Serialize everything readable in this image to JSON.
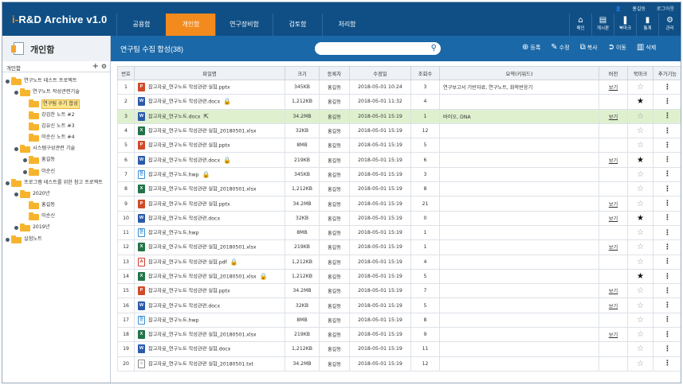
{
  "app": {
    "logo_lead": "i-",
    "logo_rest": "R&D Archive v1.0"
  },
  "util": {
    "user": "홍길동",
    "logout": "로그아웃"
  },
  "nav": [
    {
      "label": "공용함",
      "active": false
    },
    {
      "label": "개인함",
      "active": true
    },
    {
      "label": "연구장비함",
      "active": false,
      "wide": true
    },
    {
      "label": "검토함",
      "active": false
    },
    {
      "label": "처리함",
      "active": false
    }
  ],
  "tools": [
    {
      "label": "메인",
      "icon": "home-icon",
      "glyph": "⌂"
    },
    {
      "label": "게시판",
      "icon": "board-icon",
      "glyph": "▤"
    },
    {
      "label": "북마크",
      "icon": "bookmark-icon",
      "glyph": "❚"
    },
    {
      "label": "통계",
      "icon": "chart-icon",
      "glyph": "▮"
    },
    {
      "label": "관리",
      "icon": "gear-icon",
      "glyph": "⚙"
    }
  ],
  "sidebar": {
    "title": "개인함",
    "tab_label": "개인함",
    "tree": [
      {
        "label": "연구노트 테스트 프로젝트",
        "depth": 0,
        "toggle": true
      },
      {
        "label": "연구노트 작성관련기술",
        "depth": 1,
        "toggle": true
      },
      {
        "label": "연구팀 수기 합성",
        "depth": 2,
        "toggle": false,
        "selected": true
      },
      {
        "label": "강감찬 노트 #2",
        "depth": 2,
        "toggle": false
      },
      {
        "label": "김유신 노트 #3",
        "depth": 2,
        "toggle": false
      },
      {
        "label": "이순신 노트 #4",
        "depth": 2,
        "toggle": false
      },
      {
        "label": "시스템구성관련 기술",
        "depth": 1,
        "toggle": true
      },
      {
        "label": "홍길동",
        "depth": 2,
        "toggle": true
      },
      {
        "label": "이순신",
        "depth": 2,
        "toggle": true
      },
      {
        "label": "프로그램 테스트를 위한 참고 프로젝트",
        "depth": 0,
        "toggle": true
      },
      {
        "label": "2020년",
        "depth": 1,
        "toggle": true
      },
      {
        "label": "홍길동",
        "depth": 2,
        "toggle": false
      },
      {
        "label": "이순신",
        "depth": 2,
        "toggle": false
      },
      {
        "label": "2019년",
        "depth": 1,
        "toggle": true
      },
      {
        "label": "실험노트",
        "depth": 0,
        "toggle": true
      }
    ]
  },
  "main": {
    "title": "연구팀 수집 합성(38)",
    "search_placeholder": "",
    "actions": [
      {
        "label": "등록",
        "icon": "add-icon",
        "glyph": "⊕"
      },
      {
        "label": "수정",
        "icon": "edit-icon",
        "glyph": "✎"
      },
      {
        "label": "복사",
        "icon": "copy-icon",
        "glyph": "⧉"
      },
      {
        "label": "이동",
        "icon": "move-icon",
        "glyph": "➲"
      },
      {
        "label": "삭제",
        "icon": "trash-icon",
        "glyph": "▥"
      }
    ]
  },
  "table": {
    "headers": [
      "번호",
      "파일명",
      "크기",
      "등록자",
      "수정일",
      "조회수",
      "요약(키워드)",
      "버전",
      "북마크",
      "추가기능"
    ],
    "view_label": "보기",
    "rows": [
      {
        "no": "1",
        "type": "pptx",
        "name": "참고자료_연구노트 작성관련 실험.pptx",
        "lock": "",
        "size": "345KB",
        "owner": "홍길동",
        "date": "2018-05-01 10:24",
        "views": "3",
        "summary": "연구보고서 기반자료, 연구노트, 화학반응기",
        "ver": true,
        "star": false
      },
      {
        "no": "2",
        "type": "docx",
        "name": "참고자료_연구노트 작성관련.docx",
        "lock": "🔒",
        "size": "1,212KB",
        "owner": "홍길동",
        "date": "2018-05-01 11:32",
        "views": "4",
        "summary": "",
        "ver": false,
        "star": true
      },
      {
        "no": "3",
        "type": "docx",
        "name": "참고자료_연구노트.docx",
        "lock": "⇱",
        "size": "34.2MB",
        "owner": "홍길동",
        "date": "2018-05-01 15:19",
        "views": "1",
        "summary": "바이오, DNA",
        "ver": true,
        "star": false,
        "hl": true
      },
      {
        "no": "4",
        "type": "xlsx",
        "name": "참고자료_연구노트 작성관련 실험_20180501.xlsx",
        "lock": "",
        "size": "32KB",
        "owner": "홍길동",
        "date": "2018-05-01 15:19",
        "views": "12",
        "summary": "",
        "ver": false,
        "star": false
      },
      {
        "no": "5",
        "type": "pptx",
        "name": "참고자료_연구노트 작성관련 실험.pptx",
        "lock": "",
        "size": "8MB",
        "owner": "홍길동",
        "date": "2018-05-01 15:19",
        "views": "5",
        "summary": "",
        "ver": false,
        "star": false
      },
      {
        "no": "6",
        "type": "docx",
        "name": "참고자료_연구노트 작성관련.docx",
        "lock": "🔒",
        "size": "219KB",
        "owner": "홍길동",
        "date": "2018-05-01 15:19",
        "views": "6",
        "summary": "",
        "ver": true,
        "star": true
      },
      {
        "no": "7",
        "type": "hwp",
        "name": "참고자료_연구노트.hwp",
        "lock": "🔒",
        "size": "345KB",
        "owner": "홍길동",
        "date": "2018-05-01 15:19",
        "views": "3",
        "summary": "",
        "ver": false,
        "star": false
      },
      {
        "no": "8",
        "type": "xlsx",
        "name": "참고자료_연구노트 작성관련 실험_20180501.xlsx",
        "lock": "",
        "size": "1,212KB",
        "owner": "홍길동",
        "date": "2018-05-01 15:19",
        "views": "8",
        "summary": "",
        "ver": false,
        "star": false
      },
      {
        "no": "9",
        "type": "pptx",
        "name": "참고자료_연구노트 작성관련 실험.pptx",
        "lock": "",
        "size": "34.2MB",
        "owner": "홍길동",
        "date": "2018-05-01 15:19",
        "views": "21",
        "summary": "",
        "ver": true,
        "star": false
      },
      {
        "no": "10",
        "type": "docx",
        "name": "참고자료_연구노트 작성관련.docx",
        "lock": "",
        "size": "32KB",
        "owner": "홍길동",
        "date": "2018-05-01 15:19",
        "views": "0",
        "summary": "",
        "ver": true,
        "star": true
      },
      {
        "no": "11",
        "type": "hwp",
        "name": "참고자료_연구노트.hwp",
        "lock": "",
        "size": "8MB",
        "owner": "홍길동",
        "date": "2018-05-01 15:19",
        "views": "1",
        "summary": "",
        "ver": false,
        "star": false
      },
      {
        "no": "12",
        "type": "xlsx",
        "name": "참고자료_연구노트 작성관련 실험_20180501.xlsx",
        "lock": "",
        "size": "219KB",
        "owner": "홍길동",
        "date": "2018-05-01 15:19",
        "views": "1",
        "summary": "",
        "ver": true,
        "star": false
      },
      {
        "no": "13",
        "type": "pdf",
        "name": "참고자료_연구노트 작성관련 실험.pdf",
        "lock": "🔒",
        "size": "1,212KB",
        "owner": "홍길동",
        "date": "2018-05-01 15:19",
        "views": "4",
        "summary": "",
        "ver": false,
        "star": false
      },
      {
        "no": "14",
        "type": "xlsx",
        "name": "참고자료_연구노트 작성관련 실험_20180501.xlsx",
        "lock": "🔒",
        "size": "1,212KB",
        "owner": "홍길동",
        "date": "2018-05-01 15:19",
        "views": "5",
        "summary": "",
        "ver": false,
        "star": true
      },
      {
        "no": "15",
        "type": "pptx",
        "name": "참고자료_연구노트 작성관련 실험.pptx",
        "lock": "",
        "size": "34.2MB",
        "owner": "홍길동",
        "date": "2018-05-01 15:19",
        "views": "7",
        "summary": "",
        "ver": true,
        "star": false
      },
      {
        "no": "16",
        "type": "docx",
        "name": "참고자료_연구노트 작성관련.docx",
        "lock": "",
        "size": "32KB",
        "owner": "홍길동",
        "date": "2018-05-01 15:19",
        "views": "5",
        "summary": "",
        "ver": true,
        "star": false
      },
      {
        "no": "17",
        "type": "hwp",
        "name": "참고자료_연구노트.hwp",
        "lock": "",
        "size": "8MB",
        "owner": "홍길동",
        "date": "2018-05-01 15:19",
        "views": "8",
        "summary": "",
        "ver": false,
        "star": false
      },
      {
        "no": "18",
        "type": "xlsx",
        "name": "참고자료_연구노트 작성관련 실험_20180501.xlsx",
        "lock": "",
        "size": "219KB",
        "owner": "홍길동",
        "date": "2018-05-01 15:19",
        "views": "9",
        "summary": "",
        "ver": true,
        "star": false
      },
      {
        "no": "19",
        "type": "docx",
        "name": "참고자료_연구노트 작성관련 실험.docx",
        "lock": "",
        "size": "1,212KB",
        "owner": "홍길동",
        "date": "2018-05-01 15:19",
        "views": "11",
        "summary": "",
        "ver": false,
        "star": false
      },
      {
        "no": "20",
        "type": "txt",
        "name": "참고자료_연구노트 작성관련 실험_20180501.txt",
        "lock": "",
        "size": "34.2MB",
        "owner": "홍길동",
        "date": "2018-05-01 15:19",
        "views": "12",
        "summary": "",
        "ver": false,
        "star": false
      }
    ]
  }
}
